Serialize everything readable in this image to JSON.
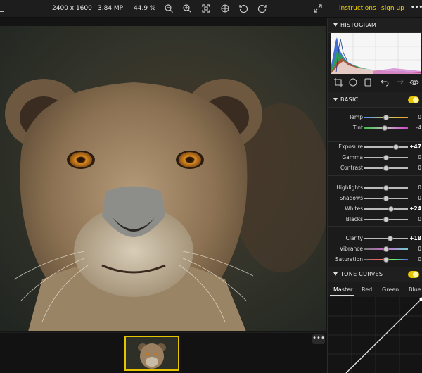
{
  "topbar": {
    "dimensions": "2400 x 1600",
    "megapixels": "3.84 MP",
    "zoom": "44.9 %",
    "instructions_label": "instructions",
    "signup_label": "sign up",
    "more_label": "•••"
  },
  "histogram": {
    "title": "HISTOGRAM"
  },
  "basic": {
    "title": "BASIC",
    "enabled": true,
    "sliders": [
      {
        "label": "Temp",
        "value": "0",
        "pos": 0.5
      },
      {
        "label": "Tint",
        "value": "-4",
        "pos": 0.47
      },
      {
        "label": "Exposure",
        "value": "+47",
        "pos": 0.73
      },
      {
        "label": "Gamma",
        "value": "0",
        "pos": 0.5
      },
      {
        "label": "Contrast",
        "value": "0",
        "pos": 0.5
      },
      {
        "label": "Highlights",
        "value": "0",
        "pos": 0.5
      },
      {
        "label": "Shadows",
        "value": "0",
        "pos": 0.5
      },
      {
        "label": "Whites",
        "value": "+24",
        "pos": 0.62
      },
      {
        "label": "Blacks",
        "value": "0",
        "pos": 0.5
      },
      {
        "label": "Clarity",
        "value": "+18",
        "pos": 0.59
      },
      {
        "label": "Vibrance",
        "value": "0",
        "pos": 0.5
      },
      {
        "label": "Saturation",
        "value": "0",
        "pos": 0.5
      }
    ]
  },
  "tone_curves": {
    "title": "TONE CURVES",
    "enabled": true,
    "tabs": [
      "Master",
      "Red",
      "Green",
      "Blue"
    ],
    "active_tab": "Master"
  },
  "filmstrip": {
    "more_label": "•••"
  },
  "colors": {
    "accent": "#f0d000"
  }
}
